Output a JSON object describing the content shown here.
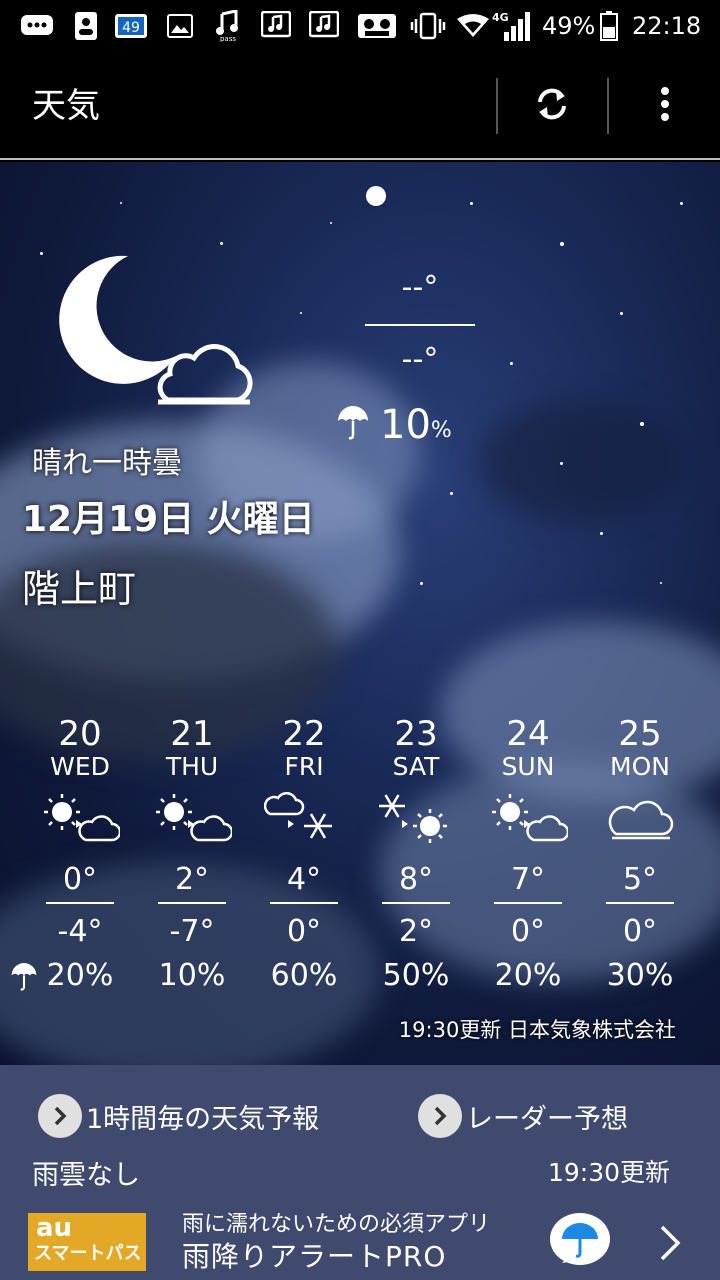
{
  "status_bar": {
    "notification_count": "49",
    "network": "4G",
    "battery": "49%",
    "time": "22:18",
    "icons": [
      "chat-icon",
      "contact-card-icon",
      "badge-49-icon",
      "image-icon",
      "music-pass-icon",
      "music-note-icon",
      "music-note-icon",
      "cassette-icon",
      "vibrate-icon",
      "wifi-icon",
      "signal-icon",
      "battery-icon"
    ]
  },
  "app_bar": {
    "title": "天気",
    "refresh_icon": "refresh-icon",
    "menu_icon": "more-vert-icon"
  },
  "current": {
    "high": "--°",
    "low": "--°",
    "precip_value": "10",
    "precip_unit": "%",
    "condition": "晴れ一時曇",
    "date": "12月19日 火曜日",
    "location": "階上町",
    "icon": "moon-partly-cloudy-icon"
  },
  "forecast": [
    {
      "day": "20",
      "dow": "WED",
      "icon": "sunny-then-cloudy-icon",
      "high": "0°",
      "low": "-4°",
      "pop": "20%"
    },
    {
      "day": "21",
      "dow": "THU",
      "icon": "sunny-then-cloudy-icon",
      "high": "2°",
      "low": "-7°",
      "pop": "10%"
    },
    {
      "day": "22",
      "dow": "FRI",
      "icon": "cloudy-then-snow-icon",
      "high": "4°",
      "low": "0°",
      "pop": "60%"
    },
    {
      "day": "23",
      "dow": "SAT",
      "icon": "snow-then-sunny-icon",
      "high": "8°",
      "low": "2°",
      "pop": "50%"
    },
    {
      "day": "24",
      "dow": "SUN",
      "icon": "sunny-then-cloudy-icon",
      "high": "7°",
      "low": "0°",
      "pop": "20%"
    },
    {
      "day": "25",
      "dow": "MON",
      "icon": "cloudy-icon",
      "high": "5°",
      "low": "0°",
      "pop": "30%"
    }
  ],
  "updated": "19:30更新 日本気象株式会社",
  "bottom": {
    "hourly_link": "1時間毎の天気予報",
    "radar_link": "レーダー予想",
    "rain_status": "雨雲なし",
    "rain_updated": "19:30更新"
  },
  "ad": {
    "logo_line1": "au",
    "logo_line2": "スマートパス",
    "subtitle": "雨に濡れないための必須アプリ",
    "title": "雨降りアラートPRO"
  }
}
